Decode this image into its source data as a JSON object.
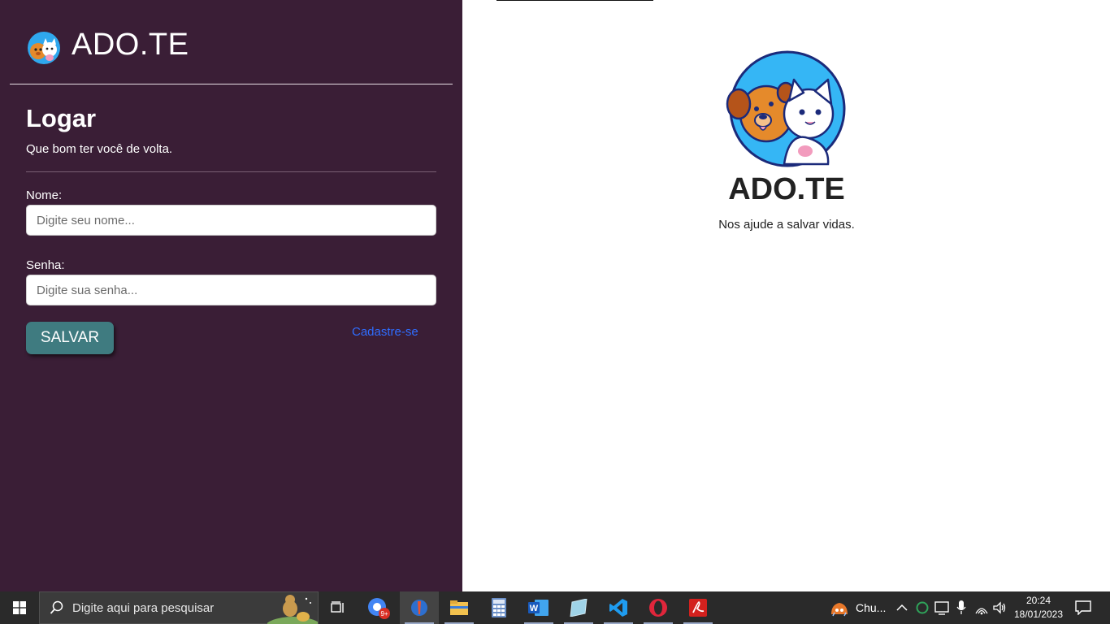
{
  "brand": {
    "title": "ADO.TE"
  },
  "login": {
    "title": "Logar",
    "subtitle": "Que bom ter você de volta.",
    "name_label": "Nome:",
    "name_placeholder": "Digite seu nome...",
    "name_value": "",
    "password_label": "Senha:",
    "password_placeholder": "Digite sua senha...",
    "password_value": "",
    "save_label": "SALVAR",
    "signup_label": "Cadastre-se"
  },
  "hero": {
    "title": "ADO.TE",
    "tagline": "Nos ajude a salvar vidas."
  },
  "taskbar": {
    "search_placeholder": "Digite aqui para pesquisar",
    "chrome_badge": "9+",
    "weather_label": "Chu...",
    "time": "20:24",
    "date": "18/01/2023"
  },
  "colors": {
    "sidebar_bg": "#3a1e36",
    "button_bg": "#3f7b80",
    "link": "#2f6dff",
    "taskbar_bg": "#2a2a2a"
  }
}
